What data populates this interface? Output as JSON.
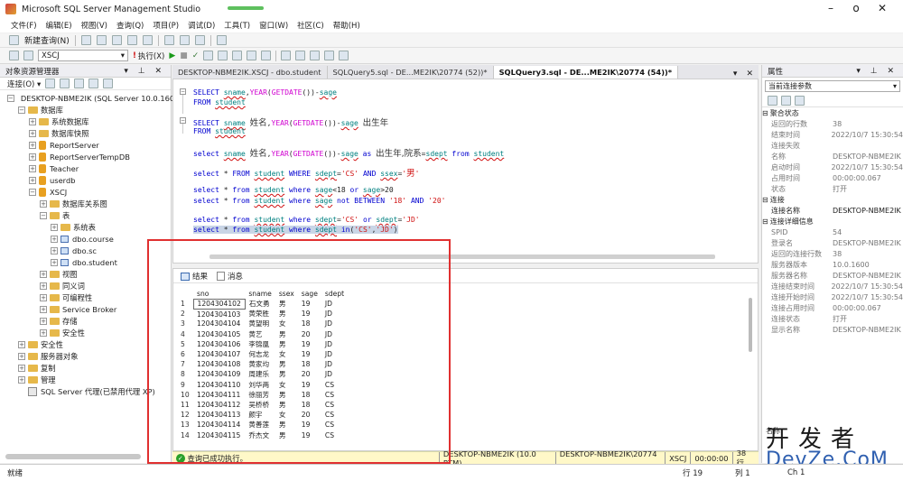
{
  "window": {
    "title": "Microsoft SQL Server Management Studio",
    "min": "–",
    "max": "o",
    "close": "✕"
  },
  "menu": [
    "文件(F)",
    "编辑(E)",
    "视图(V)",
    "查询(Q)",
    "项目(P)",
    "调试(D)",
    "工具(T)",
    "窗口(W)",
    "社区(C)",
    "帮助(H)"
  ],
  "toolbar": {
    "new_query": "新建查询(N)",
    "database": "XSCJ",
    "execute": "执行(X)"
  },
  "object_explorer": {
    "title": "对象资源管理器",
    "connect": "连接(O) ▾",
    "tree": [
      {
        "label": "DESKTOP-NBME2IK (SQL Server 10.0.160",
        "indent": 0,
        "exp": "⊟",
        "icon": "server"
      },
      {
        "label": "数据库",
        "indent": 1,
        "exp": "⊟",
        "icon": "folder"
      },
      {
        "label": "系统数据库",
        "indent": 2,
        "exp": "⊞",
        "icon": "folder"
      },
      {
        "label": "数据库快照",
        "indent": 2,
        "exp": "⊞",
        "icon": "folder"
      },
      {
        "label": "ReportServer",
        "indent": 2,
        "exp": "⊞",
        "icon": "db"
      },
      {
        "label": "ReportServerTempDB",
        "indent": 2,
        "exp": "⊞",
        "icon": "db"
      },
      {
        "label": "Teacher",
        "indent": 2,
        "exp": "⊞",
        "icon": "db"
      },
      {
        "label": "userdb",
        "indent": 2,
        "exp": "⊞",
        "icon": "db"
      },
      {
        "label": "XSCJ",
        "indent": 2,
        "exp": "⊟",
        "icon": "db"
      },
      {
        "label": "数据库关系图",
        "indent": 3,
        "exp": "⊞",
        "icon": "folder"
      },
      {
        "label": "表",
        "indent": 3,
        "exp": "⊟",
        "icon": "folder"
      },
      {
        "label": "系统表",
        "indent": 4,
        "exp": "⊞",
        "icon": "folder"
      },
      {
        "label": "dbo.course",
        "indent": 4,
        "exp": "⊞",
        "icon": "table"
      },
      {
        "label": "dbo.sc",
        "indent": 4,
        "exp": "⊞",
        "icon": "table"
      },
      {
        "label": "dbo.student",
        "indent": 4,
        "exp": "⊞",
        "icon": "table"
      },
      {
        "label": "视图",
        "indent": 3,
        "exp": "⊞",
        "icon": "folder"
      },
      {
        "label": "同义词",
        "indent": 3,
        "exp": "⊞",
        "icon": "folder"
      },
      {
        "label": "可编程性",
        "indent": 3,
        "exp": "⊞",
        "icon": "folder"
      },
      {
        "label": "Service Broker",
        "indent": 3,
        "exp": "⊞",
        "icon": "folder"
      },
      {
        "label": "存储",
        "indent": 3,
        "exp": "⊞",
        "icon": "folder"
      },
      {
        "label": "安全性",
        "indent": 3,
        "exp": "⊞",
        "icon": "folder"
      },
      {
        "label": "安全性",
        "indent": 1,
        "exp": "⊞",
        "icon": "folder"
      },
      {
        "label": "服务器对象",
        "indent": 1,
        "exp": "⊞",
        "icon": "folder"
      },
      {
        "label": "复制",
        "indent": 1,
        "exp": "⊞",
        "icon": "folder"
      },
      {
        "label": "管理",
        "indent": 1,
        "exp": "⊞",
        "icon": "folder"
      },
      {
        "label": "SQL Server 代理(已禁用代理 XP)",
        "indent": 1,
        "exp": "",
        "icon": "agent"
      }
    ]
  },
  "tabs": [
    {
      "label": "DESKTOP-NBME2IK.XSCJ - dbo.student",
      "active": false
    },
    {
      "label": "SQLQuery5.sql - DE...ME2IK\\20774 (52))*",
      "active": false
    },
    {
      "label": "SQLQuery3.sql - DE...ME2IK\\20774 (54))*",
      "active": true
    }
  ],
  "results": {
    "tab_results": "结果",
    "tab_messages": "消息",
    "columns": [
      "sno",
      "sname",
      "ssex",
      "sage",
      "sdept"
    ],
    "rows": [
      [
        "1",
        "1204304102",
        "石文勇",
        "男",
        "19",
        "JD"
      ],
      [
        "2",
        "1204304103",
        "黄荣胜",
        "男",
        "19",
        "JD"
      ],
      [
        "3",
        "1204304104",
        "黄望明",
        "女",
        "18",
        "JD"
      ],
      [
        "4",
        "1204304105",
        "黄艺",
        "男",
        "20",
        "JD"
      ],
      [
        "5",
        "1204304106",
        "李锦凰",
        "男",
        "19",
        "JD"
      ],
      [
        "6",
        "1204304107",
        "何志龙",
        "女",
        "19",
        "JD"
      ],
      [
        "7",
        "1204304108",
        "黄家均",
        "男",
        "18",
        "JD"
      ],
      [
        "8",
        "1204304109",
        "周建乐",
        "男",
        "20",
        "JD"
      ],
      [
        "9",
        "1204304110",
        "刘华两",
        "女",
        "19",
        "CS"
      ],
      [
        "10",
        "1204304111",
        "徐丽芳",
        "男",
        "18",
        "CS"
      ],
      [
        "11",
        "1204304112",
        "吴桥桥",
        "男",
        "18",
        "CS"
      ],
      [
        "12",
        "1204304113",
        "颜宇",
        "女",
        "20",
        "CS"
      ],
      [
        "13",
        "1204304114",
        "黄善莲",
        "男",
        "19",
        "CS"
      ],
      [
        "14",
        "1204304115",
        "乔杰文",
        "男",
        "19",
        "CS"
      ]
    ]
  },
  "query_status": {
    "message": "查询已成功执行。",
    "server": "DESKTOP-NBME2IK (10.0 RTM)",
    "user": "DESKTOP-NBME2IK\\20774 ...",
    "db": "XSCJ",
    "time": "00:00:00",
    "rows": "38 行"
  },
  "statusbar": {
    "ready": "就绪",
    "line": "行 19",
    "col": "列 1",
    "ch": "Ch 1"
  },
  "properties": {
    "title": "属性",
    "combo": "当前连接参数",
    "rows": [
      {
        "k": "聚合状态",
        "v": "",
        "type": "cat"
      },
      {
        "k": "返回的行数",
        "v": "38",
        "type": "row"
      },
      {
        "k": "结束时间",
        "v": "2022/10/7 15:30:54",
        "type": "row"
      },
      {
        "k": "连接失败",
        "v": "",
        "type": "row"
      },
      {
        "k": "名称",
        "v": "DESKTOP-NBME2IK",
        "type": "row"
      },
      {
        "k": "启动时间",
        "v": "2022/10/7 15:30:54",
        "type": "row"
      },
      {
        "k": "占用时间",
        "v": "00:00:00.067",
        "type": "row"
      },
      {
        "k": "状态",
        "v": "打开",
        "type": "row"
      },
      {
        "k": "连接",
        "v": "",
        "type": "cat"
      },
      {
        "k": "连接名称",
        "v": "DESKTOP-NBME2IK",
        "type": "bold"
      },
      {
        "k": "连接详细信息",
        "v": "",
        "type": "cat"
      },
      {
        "k": "SPID",
        "v": "54",
        "type": "row"
      },
      {
        "k": "登录名",
        "v": "DESKTOP-NBME2IK",
        "type": "row"
      },
      {
        "k": "返回的连接行数",
        "v": "38",
        "type": "row"
      },
      {
        "k": "服务器版本",
        "v": "10.0.1600",
        "type": "row"
      },
      {
        "k": "服务器名称",
        "v": "DESKTOP-NBME2IK",
        "type": "row"
      },
      {
        "k": "连接结束时间",
        "v": "2022/10/7 15:30:54",
        "type": "row"
      },
      {
        "k": "连接开始时间",
        "v": "2022/10/7 15:30:54",
        "type": "row"
      },
      {
        "k": "连接占用时间",
        "v": "00:00:00.067",
        "type": "row"
      },
      {
        "k": "连接状态",
        "v": "打开",
        "type": "row"
      },
      {
        "k": "显示名称",
        "v": "DESKTOP-NBME2IK",
        "type": "row"
      }
    ],
    "desc": "名称"
  },
  "watermark": {
    "line1": "开发者",
    "line2": "DevZe.CoM"
  }
}
